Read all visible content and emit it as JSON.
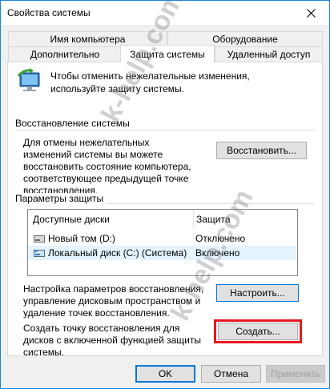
{
  "window": {
    "title": "Свойства системы"
  },
  "tabs": {
    "row1": [
      "Имя компьютера",
      "Оборудование"
    ],
    "row2": [
      "Дополнительно",
      "Защита системы",
      "Удаленный доступ"
    ],
    "active": "Защита системы"
  },
  "intro": {
    "text": "Чтобы отменить нежелательные изменения, используйте защиту системы."
  },
  "restore": {
    "section_label": "Восстановление системы",
    "description": "Для отмены нежелательных изменений системы вы можете восстановить состояние компьютера, соответствующее предыдущей точке восстановления.",
    "button_label": "Восстановить..."
  },
  "protection": {
    "section_label": "Параметры защиты",
    "columns": [
      "Доступные диски",
      "Защита"
    ],
    "drives": [
      {
        "name": "Новый том (D:)",
        "status": "Отключено",
        "selected": false
      },
      {
        "name": "Локальный диск (C:) (Система)",
        "status": "Включено",
        "selected": true
      }
    ],
    "configure_text": "Настройка параметров восстановления, управление дисковым пространством и удаление точек восстановления.",
    "configure_button": "Настроить...",
    "create_text": "Создать точку восстановления для дисков с включенной функцией защиты системы.",
    "create_button": "Создать..."
  },
  "footer": {
    "ok": "OK",
    "cancel": "Отмена",
    "apply": "Применить"
  },
  "watermark": {
    "text": "k-help.com"
  },
  "colors": {
    "window_border": "#1883d7",
    "highlight": "#e8181d",
    "selected_row": "#e5f3ff",
    "focus_border": "#0078d7"
  }
}
